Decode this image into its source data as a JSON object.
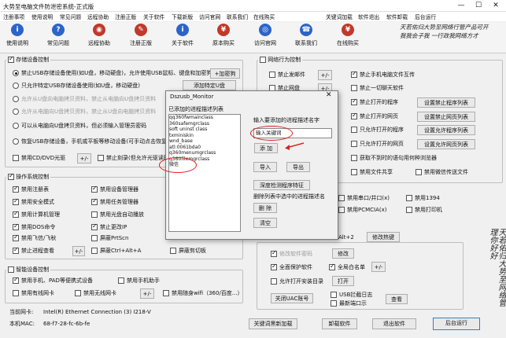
{
  "window": {
    "title": "大势至电脑文件防泄密系统-正式版",
    "minimize": "—",
    "maximize": "☐",
    "close": "✕"
  },
  "menu_left": [
    "注册事项",
    "使用说明",
    "常见问题",
    "远程协助",
    "注册正版",
    "关于软件",
    "下载新版",
    "访问官网",
    "联系我们",
    "在线购买"
  ],
  "menu_right": [
    "关键词加载",
    "软件退出",
    "软件卸载",
    "后台运行"
  ],
  "toolbar": [
    {
      "label": "使用说明",
      "icon": "book-icon",
      "color": "#2d64c8",
      "glyph": "i"
    },
    {
      "label": "常见问题",
      "icon": "question-icon",
      "color": "#2d64c8",
      "glyph": "?"
    },
    {
      "label": "远程协助",
      "icon": "remote-icon",
      "color": "#c0392b",
      "glyph": "◉"
    },
    {
      "label": "注册正版",
      "icon": "register-icon",
      "color": "#c0392b",
      "glyph": "✎"
    },
    {
      "label": "关于软件",
      "icon": "about-icon",
      "color": "#2d64c8",
      "glyph": "i"
    },
    {
      "label": "原本购买",
      "icon": "cart-icon",
      "color": "#c0392b",
      "glyph": "¥"
    },
    {
      "label": "访问官网",
      "icon": "globe-icon",
      "color": "#2d64c8",
      "glyph": "◎"
    },
    {
      "label": "联系我们",
      "icon": "contact-icon",
      "color": "#2d64c8",
      "glyph": "☎"
    },
    {
      "label": "在线购买",
      "icon": "shop-icon",
      "color": "#c0392b",
      "glyph": "¥"
    }
  ],
  "calligraphy_top": [
    "天若佑归大势至网络行管产品可开",
    "我我会子我 一行政我网络方才"
  ],
  "storage": {
    "title": "存储设备控制",
    "opts": [
      {
        "text": "禁止USB存储设备使用(如U盘，移动硬盘)，允许使用USB鼠标、键盘和加密狗",
        "checked": true
      },
      {
        "text": "只允许特定USB存储设备使用(如U盘，移动硬盘)",
        "checked": false
      },
      {
        "text": "允许从U盘向电脑拷贝资料，禁止从电脑向U盘拷贝资料",
        "checked": false
      },
      {
        "text": "允许从电脑向U盘拷贝资料，禁止从U盘向电脑拷贝资料",
        "checked": false
      },
      {
        "text": "可以从电脑向U盘拷贝资料，但必须输入管理员密码",
        "checked": false
      },
      {
        "text": "恢复USB存储设备，手机或平板等移动设备(可手动点击恢复按钮)",
        "checked": false
      }
    ],
    "encrypt_btn": "+加密狗",
    "add_usb_btn": "添加特定U盘",
    "cdrom_label": "禁用CD/DVD光驱",
    "cdrom_plus": "+/-",
    "writeable_label": "禁止刻录(但允许光驱读取)"
  },
  "ops": {
    "title": "操作系统控制",
    "items": [
      {
        "text": "禁用注册表",
        "checked": true
      },
      {
        "text": "禁用安全模式",
        "checked": true
      },
      {
        "text": "禁用计算机管理",
        "checked": true
      },
      {
        "text": "禁用DOS命令",
        "checked": true
      },
      {
        "text": "禁用飞信/飞秋",
        "checked": true
      },
      {
        "text": "禁止进程查看",
        "checked": true
      },
      {
        "text": "禁用设备管理器",
        "checked": true
      },
      {
        "text": "禁用任务管理器",
        "checked": true
      },
      {
        "text": "禁用光盘自动播放",
        "checked": false
      },
      {
        "text": "禁止更改IP",
        "checked": true
      },
      {
        "text": "屏蔽PrtScn",
        "checked": false
      },
      {
        "text": "屏蔽Ctrl+Alt+A",
        "checked": false
      },
      {
        "text": "屏蔽剪切板",
        "checked": false
      }
    ],
    "plus": "+/-"
  },
  "smart": {
    "title": "智能设备控制",
    "items": [
      {
        "text": "禁用手机、PAD等便携式设备",
        "checked": true
      },
      {
        "text": "禁用手机助手",
        "checked": false
      },
      {
        "text": "禁用有线网卡",
        "checked": false
      },
      {
        "text": "禁用无线网卡",
        "checked": false
      },
      {
        "text": "禁用随身wifi（360/百度...）",
        "checked": false
      }
    ],
    "plus": "+/-"
  },
  "net": {
    "title": "网络行为控制",
    "items": [
      {
        "text": "禁止发邮件",
        "checked": false
      },
      {
        "text": "禁止网盘",
        "checked": false
      },
      {
        "text": "禁止手机电脑文件互传",
        "checked": true
      },
      {
        "text": "禁止一切聊天软件",
        "checked": false
      },
      {
        "text": "禁止打开的程序",
        "checked": true
      },
      {
        "text": "禁止打开的网页",
        "checked": true
      },
      {
        "text": "只允许打开的程序",
        "checked": false
      },
      {
        "text": "只允许打开的网页",
        "checked": false
      },
      {
        "text": "获取不到时的语句用何种浏览器",
        "checked": false
      },
      {
        "text": "禁用文件共享",
        "checked": false
      },
      {
        "text": "禁用微信传送文件",
        "checked": false
      }
    ],
    "plus": "+/-",
    "btns": [
      "设置禁止程序列表",
      "设置禁止网页列表",
      "设置允许程序列表",
      "设置允许网页列表"
    ]
  },
  "ports": {
    "title": "端口控制",
    "items": [
      {
        "text": "禁用串口/并口(x)",
        "checked": false
      },
      {
        "text": "禁用1394",
        "checked": false
      },
      {
        "text": "禁用PCMCIA(x)",
        "checked": false
      },
      {
        "text": "禁用打印机",
        "checked": false
      }
    ]
  },
  "hotkey": {
    "label": "Alt+2",
    "btn": "修改热键"
  },
  "security": {
    "modify_pwd": "修改软件密码",
    "modify_btn": "修改",
    "fullprotect": "全面保护软件",
    "whitelist": "全局白名单",
    "whitelist_plus": "+/-",
    "allow_open": "允许打开安装目录",
    "open_btn": "打开",
    "uac_btn": "关闭UAC账号",
    "usb_log": "USB拦截日志",
    "recent": "最新端口示",
    "view_btn": "查看"
  },
  "calligraphy_right": "天若佑归大势至网络管理你好好",
  "status": {
    "nic_label": "当前网卡:",
    "nic_value": "Intel(R) Ethernet Connection (3) I218-V",
    "mac_label": "本机MAC:",
    "mac_value": "68-f7-28-fc-6b-fe",
    "buttons": [
      "关键词黑新加载",
      "卸载软件",
      "退出软件",
      "后台运行"
    ]
  },
  "dialog": {
    "title": "Dszusb_Monitor",
    "close": "✕",
    "list_label": "已添加的进程描述列表",
    "list": [
      "qq360fwmainclass",
      "360safemgrclass",
      "soft uninst class",
      "txminiskin",
      "wnd_base",
      "atl:0061bda0",
      "q360menumgrclass",
      "q360filemgrclass",
      "微信"
    ],
    "input_label": "输入要添加的进程描述名字",
    "input_value": "输入关键词",
    "add_btn": "添 加",
    "import_btn": "导入",
    "export_btn": "导出",
    "deep_btn": "深度检测程序特征",
    "delete_label": "删除列表中选中的进程描述名",
    "delete_btn": "删 除",
    "clear_btn": "清空"
  }
}
